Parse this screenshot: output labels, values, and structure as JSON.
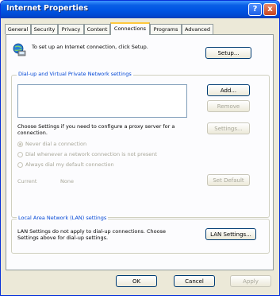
{
  "window": {
    "title": "Internet Properties",
    "help_label": "?",
    "close_label": "x"
  },
  "tabs": [
    {
      "label": "General"
    },
    {
      "label": "Security"
    },
    {
      "label": "Privacy"
    },
    {
      "label": "Content"
    },
    {
      "label": "Connections"
    },
    {
      "label": "Programs"
    },
    {
      "label": "Advanced"
    }
  ],
  "setup": {
    "text": "To set up an Internet connection, click Setup.",
    "button": "Setup..."
  },
  "dialup": {
    "legend": "Dial-up and Virtual Private Network settings",
    "add_button": "Add...",
    "remove_button": "Remove",
    "settings_button": "Settings...",
    "choose_text": "Choose Settings if you need to configure a proxy server for a connection.",
    "radio_never": "Never dial a connection",
    "radio_whenever": "Dial whenever a network connection is not present",
    "radio_always": "Always dial my default connection",
    "current_label": "Current",
    "current_value": "None",
    "set_default_button": "Set Default"
  },
  "lan": {
    "legend": "Local Area Network (LAN) settings",
    "text": "LAN Settings do not apply to dial-up connections. Choose Settings above for dial-up settings.",
    "button": "LAN Settings..."
  },
  "footer": {
    "ok": "OK",
    "cancel": "Cancel",
    "apply": "Apply"
  }
}
